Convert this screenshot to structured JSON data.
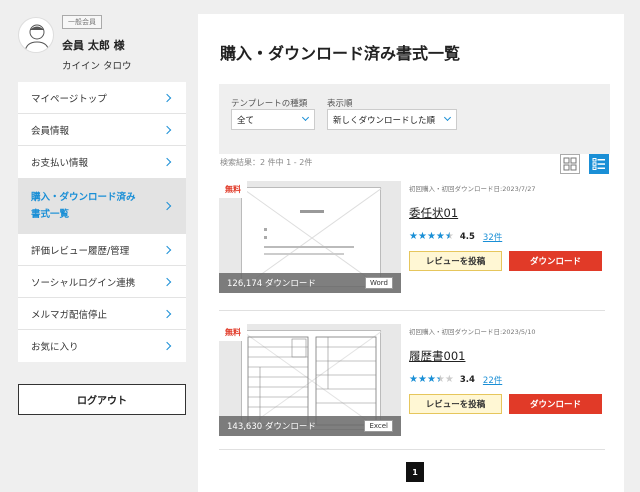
{
  "profile": {
    "badge": "一般会員",
    "name": "会員 太郎 様",
    "kana": "カイイン タロウ"
  },
  "sidebar": {
    "items": [
      {
        "label": "マイページトップ"
      },
      {
        "label": "会員情報"
      },
      {
        "label": "お支払い情報"
      },
      {
        "label": "購入・ダウンロード済み書式一覧",
        "line1": "購入・ダウンロード済み",
        "line2": "書式一覧",
        "active": true
      },
      {
        "label": "評価レビュー履歴/管理"
      },
      {
        "label": "ソーシャルログイン連携"
      },
      {
        "label": "メルマガ配信停止"
      },
      {
        "label": "お気に入り"
      }
    ],
    "logout_label": "ログアウト"
  },
  "main": {
    "title": "購入・ダウンロード済み書式一覧",
    "filter": {
      "type_label": "テンプレートの種類",
      "type_value": "全て",
      "order_label": "表示順",
      "order_value": "新しくダウンロードした順"
    },
    "results_text": "検索結果：2 件中 1 - 2件",
    "view_modes": {
      "grid": "grid-view-icon",
      "list": "list-view-icon",
      "active": "list"
    },
    "documents": [
      {
        "free_label": "無料",
        "downloads": "126,174 ダウンロード",
        "file_type": "Word",
        "meta": "初回購入・初回ダウンロード日:2023/7/27",
        "title": "委任状01",
        "rating": "4.5",
        "rating_value": 4.5,
        "review_count": "32件",
        "review_button": "レビューを投稿",
        "download_button": "ダウンロード"
      },
      {
        "free_label": "無料",
        "downloads": "143,630 ダウンロード",
        "file_type": "Excel",
        "meta": "初回購入・初回ダウンロード日:2023/5/10",
        "title": "履歴書001",
        "rating": "3.4",
        "rating_value": 3.4,
        "review_count": "22件",
        "review_button": "レビューを投稿",
        "download_button": "ダウンロード"
      }
    ],
    "pagination": {
      "current": "1"
    }
  },
  "colors": {
    "accent": "#1a8fd6",
    "download": "#e13a28",
    "review_bg": "#fff7d4"
  }
}
